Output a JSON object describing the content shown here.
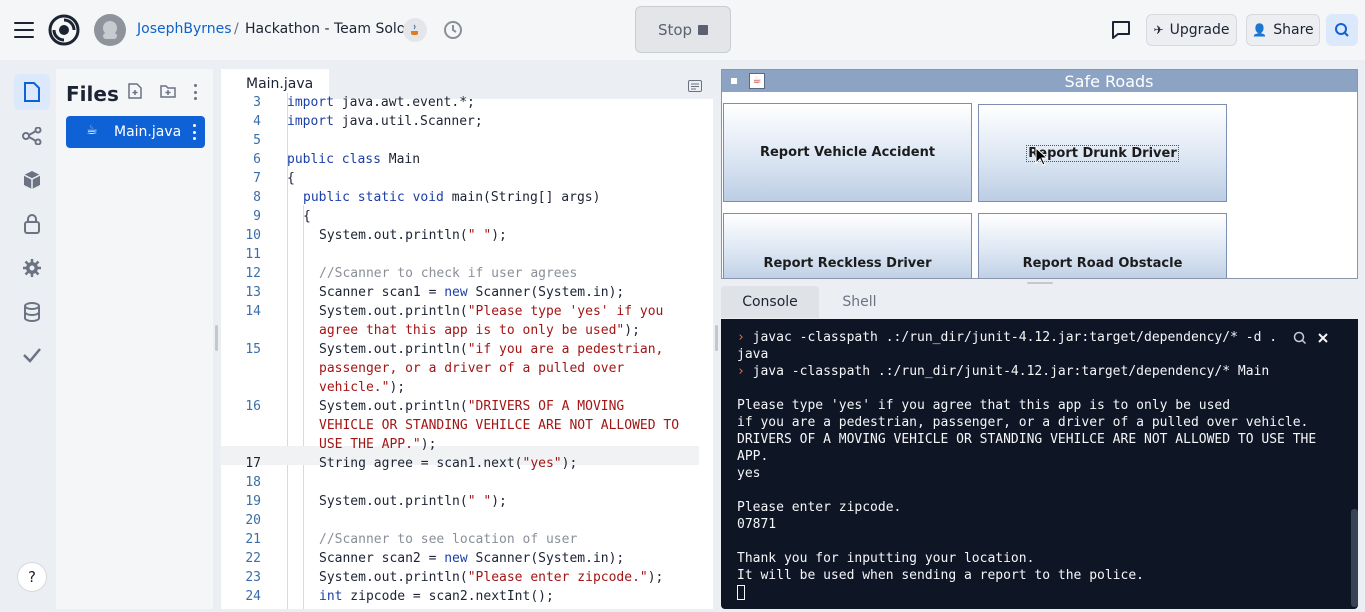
{
  "topbar": {
    "user": "JosephByrnes",
    "separator": "/",
    "project": "Hackathon - Team Solo",
    "stop_label": "Stop",
    "upgrade_label": "Upgrade",
    "share_label": "Share"
  },
  "files": {
    "title": "Files",
    "items": [
      {
        "label": "Main.java"
      }
    ]
  },
  "editor": {
    "tab_label": "Main.java",
    "lines": [
      {
        "n": "3",
        "text": "import java.awt.event.*;"
      },
      {
        "n": "4",
        "text": "import java.util.Scanner;"
      },
      {
        "n": "5",
        "text": ""
      },
      {
        "n": "6",
        "text": "public class Main"
      },
      {
        "n": "7",
        "text": "{"
      },
      {
        "n": "8",
        "text": "public static void main(String[] args)"
      },
      {
        "n": "9",
        "text": "{"
      },
      {
        "n": "10",
        "text": "System.out.println(\" \");"
      },
      {
        "n": "11",
        "text": ""
      },
      {
        "n": "12",
        "text": "//Scanner to check if user agrees"
      },
      {
        "n": "13",
        "text": "Scanner scan1 = new Scanner(System.in);"
      },
      {
        "n": "14",
        "text": "System.out.println(\"Please type 'yes' if you agree that this app is to only be used\");"
      },
      {
        "n": "15",
        "text": "System.out.println(\"if you are a pedestrian, passenger, or a driver of a pulled over vehicle.\");"
      },
      {
        "n": "16",
        "text": "System.out.println(\"DRIVERS OF A MOVING VEHICLE OR STANDING VEHILCE ARE NOT ALLOWED TO USE THE APP.\");"
      },
      {
        "n": "17",
        "text": "String agree = scan1.next(\"yes\");"
      },
      {
        "n": "18",
        "text": ""
      },
      {
        "n": "19",
        "text": "System.out.println(\" \");"
      },
      {
        "n": "20",
        "text": ""
      },
      {
        "n": "21",
        "text": "//Scanner to see location of user"
      },
      {
        "n": "22",
        "text": "Scanner scan2 = new Scanner(System.in);"
      },
      {
        "n": "23",
        "text": "System.out.println(\"Please enter zipcode.\");"
      },
      {
        "n": "24",
        "text": "int zipcode = scan2.nextInt();"
      }
    ]
  },
  "app_window": {
    "title": "Safe Roads",
    "buttons": [
      "Report Vehicle Accident",
      "Report Drunk Driver",
      "Report Reckless Driver",
      "Report Road Obstacle"
    ]
  },
  "console": {
    "tabs": [
      "Console",
      "Shell"
    ],
    "active_tab": "Console",
    "lines": [
      {
        "prompt": true,
        "text": "javac -classpath .:/run_dir/junit-4.12.jar:target/dependency/* -d ."
      },
      {
        "prompt": false,
        "text": "java"
      },
      {
        "prompt": true,
        "text": "java -classpath .:/run_dir/junit-4.12.jar:target/dependency/* Main"
      },
      {
        "prompt": false,
        "text": ""
      },
      {
        "prompt": false,
        "text": "Please type 'yes' if you agree that this app is to only be used"
      },
      {
        "prompt": false,
        "text": "if you are a pedestrian, passenger, or a driver of a pulled over vehicle."
      },
      {
        "prompt": false,
        "text": "DRIVERS OF A MOVING VEHICLE OR STANDING VEHILCE ARE NOT ALLOWED TO USE THE"
      },
      {
        "prompt": false,
        "text": "APP."
      },
      {
        "prompt": false,
        "text": "yes"
      },
      {
        "prompt": false,
        "text": ""
      },
      {
        "prompt": false,
        "text": "Please enter zipcode."
      },
      {
        "prompt": false,
        "text": "07871"
      },
      {
        "prompt": false,
        "text": ""
      },
      {
        "prompt": false,
        "text": "Thank you for inputting your location."
      },
      {
        "prompt": false,
        "text": "It will be used when sending a report to the police."
      }
    ]
  },
  "help_label": "?",
  "colors": {
    "accent": "#0f62d6",
    "link": "#0d63c9",
    "terminal_bg": "#0e1525",
    "prompt": "#f26e3a"
  }
}
